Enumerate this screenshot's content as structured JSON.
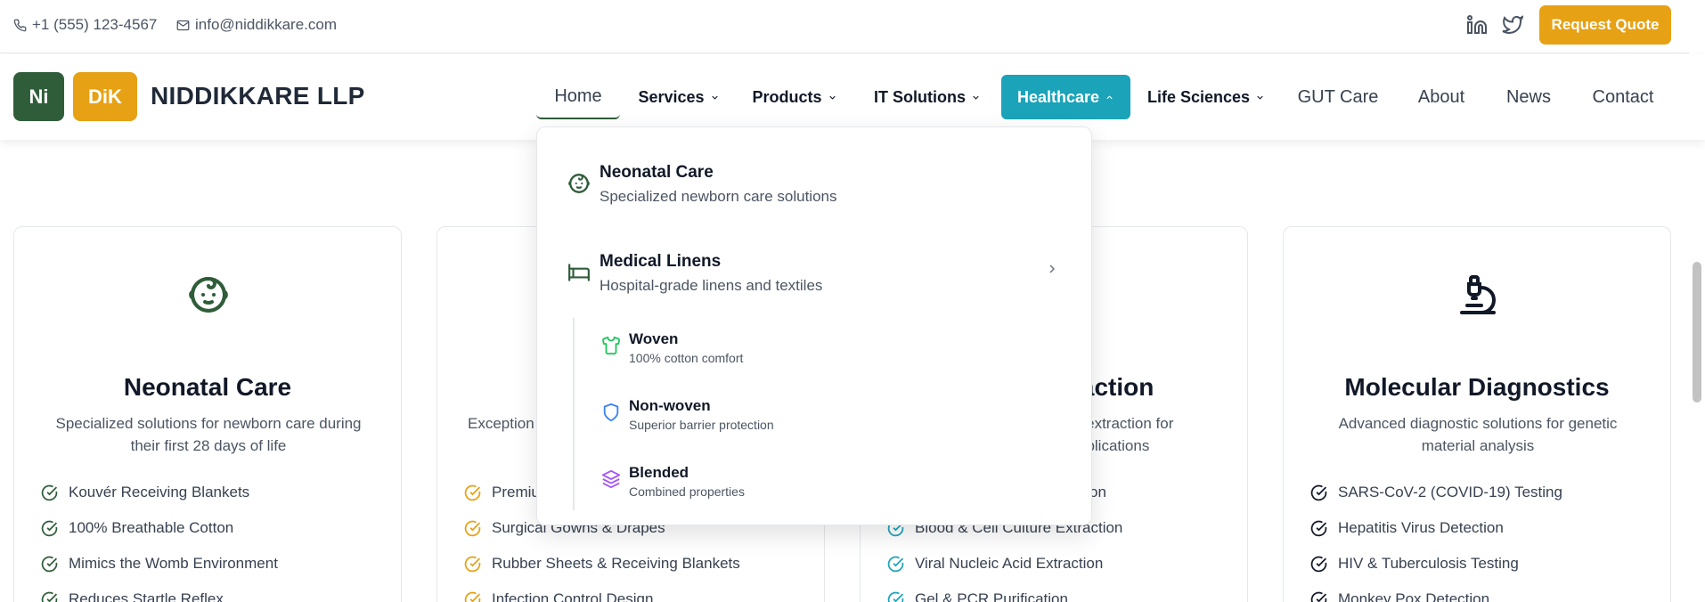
{
  "topbar": {
    "phone": "+1 (555) 123-4567",
    "email": "info@niddikkare.com",
    "social": [
      "linkedin-icon",
      "twitter-icon"
    ],
    "quote_label": "Request Quote"
  },
  "brand": {
    "logo_left": "Ni",
    "logo_right": "DiK",
    "name": "NIDDIKKARE LLP"
  },
  "nav": {
    "home": "Home",
    "services": "Services",
    "products": "Products",
    "it_solutions": "IT Solutions",
    "healthcare": "Healthcare",
    "life_sciences": "Life Sciences",
    "gut_care": "GUT Care",
    "about": "About",
    "news": "News",
    "contact": "Contact"
  },
  "dropdown": {
    "items": [
      {
        "title": "Neonatal Care",
        "desc": "Specialized newborn care solutions",
        "icon": "baby-icon"
      },
      {
        "title": "Medical Linens",
        "desc": "Hospital-grade linens and textiles",
        "icon": "bed-icon"
      }
    ],
    "sub_items": [
      {
        "title": "Woven",
        "desc": "100% cotton comfort",
        "icon": "shirt-icon"
      },
      {
        "title": "Non-woven",
        "desc": "Superior barrier protection",
        "icon": "shield-icon"
      },
      {
        "title": "Blended",
        "desc": "Combined properties",
        "icon": "layers-icon"
      }
    ]
  },
  "cards": [
    {
      "title": "Neonatal Care",
      "desc": "Specialized solutions for newborn care during their first 28 days of life",
      "icon": "baby-icon",
      "features": [
        "Kouvér Receiving Blankets",
        "100% Breathable Cotton",
        "Mimics the Womb Environment",
        "Reduces Startle Reflex"
      ]
    },
    {
      "title": "",
      "desc": "Exception",
      "icon": "",
      "features": [
        "Premiu",
        "Surgical Gowns & Drapes",
        "Rubber Sheets & Receiving Blankets",
        "Infection Control Design"
      ]
    },
    {
      "title": "raction",
      "desc_line1": "A extraction for",
      "desc_line2": "pplications",
      "icon": "",
      "features": [
        "ction",
        "Blood & Cell Culture Extraction",
        "Viral Nucleic Acid Extraction",
        "Gel & PCR Purification"
      ]
    },
    {
      "title": "Molecular Diagnostics",
      "desc": "Advanced diagnostic solutions for genetic material analysis",
      "icon": "microscope-icon",
      "features": [
        "SARS-CoV-2 (COVID-19) Testing",
        "Hepatitis Virus Detection",
        "HIV & Tuberculosis Testing",
        "Monkey Pox Detection"
      ]
    }
  ],
  "colors": {
    "brand_green": "#2f5d3a",
    "brand_gold": "#e6a114",
    "accent_teal": "#1aa3b9"
  }
}
